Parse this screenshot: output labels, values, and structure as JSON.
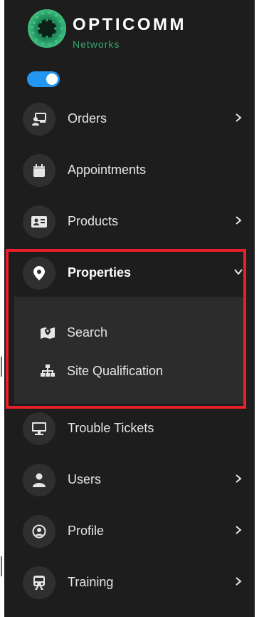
{
  "brand": {
    "name": "OPTICOMM",
    "subtitle": "Networks"
  },
  "toggle": {
    "state": "on"
  },
  "nav": {
    "orders": {
      "label": "Orders",
      "icon": "desk-user-icon"
    },
    "appointments": {
      "label": "Appointments",
      "icon": "calendar-icon"
    },
    "products": {
      "label": "Products",
      "icon": "id-card-icon"
    },
    "properties": {
      "label": "Properties",
      "icon": "map-pin-icon",
      "expanded": true,
      "children": [
        {
          "label": "Search",
          "icon": "map-search-icon"
        },
        {
          "label": "Site Qualification",
          "icon": "sitemap-icon"
        }
      ]
    },
    "trouble_tickets": {
      "label": "Trouble Tickets",
      "icon": "monitor-icon"
    },
    "users": {
      "label": "Users",
      "icon": "user-icon"
    },
    "profile": {
      "label": "Profile",
      "icon": "user-circle-icon"
    },
    "training": {
      "label": "Training",
      "icon": "train-icon"
    }
  },
  "colors": {
    "sidebar_bg": "#1d1d1d",
    "submenu_bg": "#2c2c2c",
    "icon_circle": "#2f2f2f",
    "accent_blue": "#2196f3",
    "brand_green": "#34a56a",
    "highlight_red": "#e8202a"
  }
}
